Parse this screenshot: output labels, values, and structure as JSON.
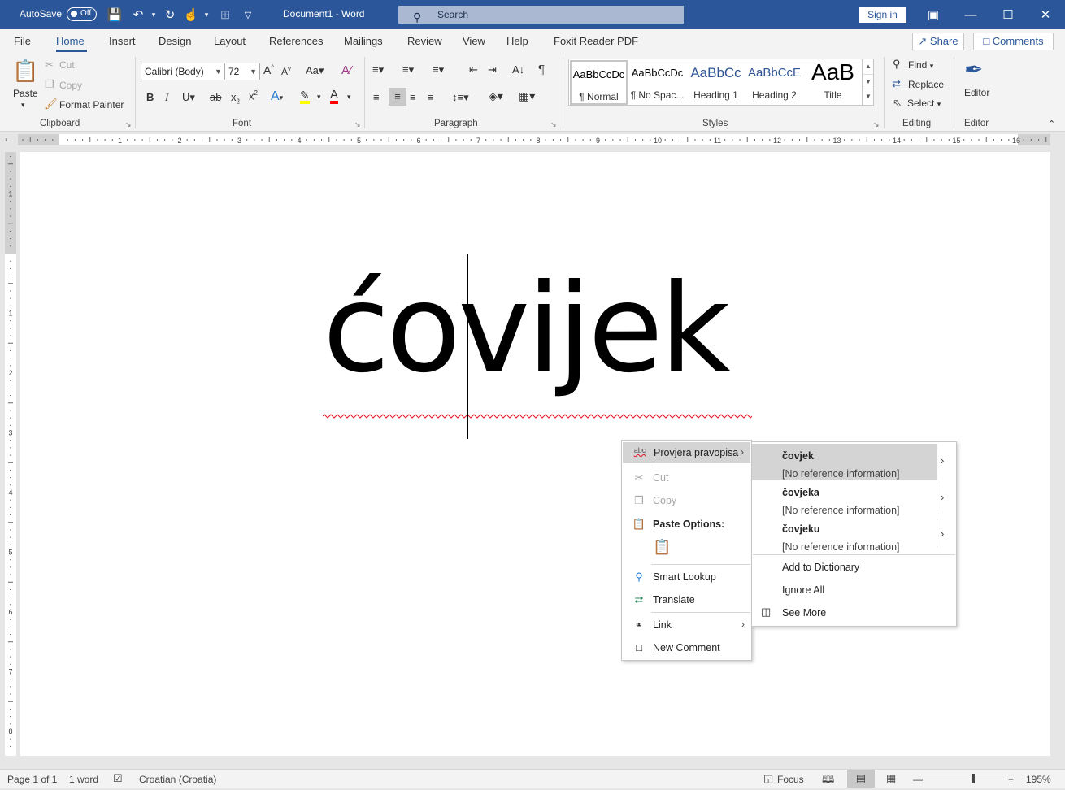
{
  "titlebar": {
    "autosave_label": "AutoSave",
    "autosave_state": "Off",
    "doc_title": "Document1 - Word",
    "search_placeholder": "Search",
    "signin_label": "Sign in"
  },
  "menu": {
    "tabs": [
      "File",
      "Home",
      "Insert",
      "Design",
      "Layout",
      "References",
      "Mailings",
      "Review",
      "View",
      "Help",
      "Foxit Reader PDF"
    ],
    "active_tab": "Home",
    "share_label": "Share",
    "comments_label": "Comments"
  },
  "ribbon": {
    "clipboard": {
      "paste": "Paste",
      "cut": "Cut",
      "copy": "Copy",
      "format_painter": "Format Painter",
      "label": "Clipboard"
    },
    "font": {
      "name": "Calibri (Body)",
      "size": "72",
      "label": "Font"
    },
    "paragraph": {
      "label": "Paragraph"
    },
    "styles": {
      "items": [
        {
          "preview": "AaBbCcDc",
          "name": "¶ Normal"
        },
        {
          "preview": "AaBbCcDc",
          "name": "¶ No Spac..."
        },
        {
          "preview": "AaBbCc",
          "name": "Heading 1"
        },
        {
          "preview": "AaBbCcE",
          "name": "Heading 2"
        },
        {
          "preview": "AaB",
          "name": "Title"
        }
      ],
      "label": "Styles"
    },
    "editing": {
      "find": "Find",
      "replace": "Replace",
      "select": "Select",
      "label": "Editing"
    },
    "editor": {
      "button": "Editor",
      "label": "Editor"
    }
  },
  "ruler": {
    "h_marks": [
      "1",
      "1",
      "2",
      "3",
      "4",
      "5",
      "6",
      "7",
      "8",
      "9",
      "10",
      "11",
      "12",
      "13",
      "14",
      "15",
      "16"
    ],
    "v_marks": [
      "1",
      "1",
      "2",
      "3",
      "4",
      "5",
      "6",
      "7",
      "8"
    ]
  },
  "document": {
    "text": "ćovijek"
  },
  "context_menu": {
    "spell_item": "Provjera pravopisa",
    "cut": "Cut",
    "copy": "Copy",
    "paste_options": "Paste Options:",
    "smart_lookup": "Smart Lookup",
    "translate": "Translate",
    "link": "Link",
    "new_comment": "New Comment"
  },
  "submenu": {
    "suggestions": [
      {
        "word": "čovjek",
        "ref": "[No reference information]"
      },
      {
        "word": "čovjeka",
        "ref": "[No reference information]"
      },
      {
        "word": "čovjeku",
        "ref": "[No reference information]"
      }
    ],
    "add_to_dictionary": "Add to Dictionary",
    "ignore_all": "Ignore All",
    "see_more": "See More"
  },
  "statusbar": {
    "page": "Page 1 of 1",
    "words": "1 word",
    "language": "Croatian (Croatia)",
    "focus": "Focus",
    "zoom": "195%"
  },
  "colors": {
    "accent": "#2b579a",
    "highlight": "#ffff00",
    "font_color": "#ff0000",
    "squiggle": "#e81123"
  }
}
